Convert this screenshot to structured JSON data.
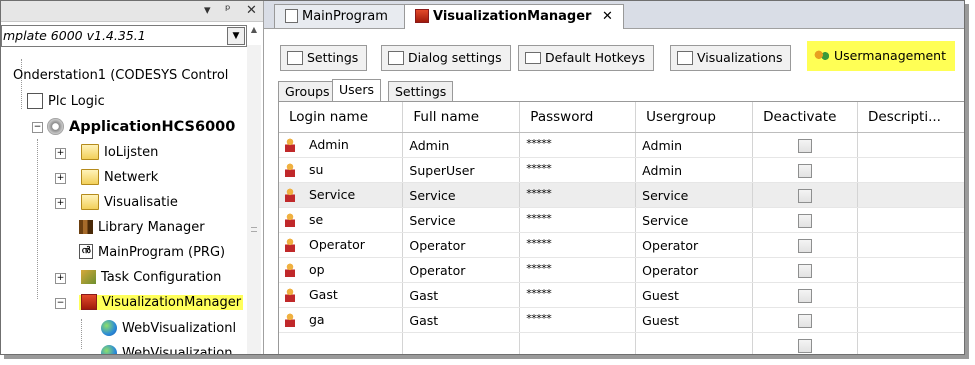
{
  "left_panel": {
    "header_buttons": [
      "▾",
      "ᵖ",
      "✕"
    ],
    "combo_text": "mplate 6000 v1.4.35.1",
    "device": "Onderstation1 (CODESYS Control",
    "plc_logic": "Plc Logic",
    "application": "ApplicationHCS6000",
    "items": [
      {
        "label": "IoLijsten",
        "icon": "folder-icon"
      },
      {
        "label": "Netwerk",
        "icon": "folder-icon"
      },
      {
        "label": "Visualisatie",
        "icon": "folder-icon"
      },
      {
        "label": "Library Manager",
        "icon": "library-icon"
      },
      {
        "label": "MainProgram (PRG)",
        "icon": "program-icon"
      },
      {
        "label": "Task Configuration",
        "icon": "task-icon"
      },
      {
        "label": "VisualizationManager",
        "icon": "visu-manager-icon"
      },
      {
        "label": "WebVisualizationl",
        "icon": "web-visu-icon"
      },
      {
        "label": "WebVisualization",
        "icon": "web-visu-icon"
      }
    ]
  },
  "editor": {
    "doc_tabs": [
      {
        "label": "MainProgram"
      },
      {
        "label": "VisualizationManager"
      }
    ],
    "close_label": "✕",
    "sub_tabs": [
      "Settings",
      "Dialog settings",
      "Default Hotkeys",
      "Visualizations",
      "Usermanagement"
    ],
    "inner_tabs": [
      "Groups",
      "Users",
      "Settings"
    ],
    "columns": [
      "Login name",
      "Full name",
      "Password",
      "Usergroup",
      "Deactivate",
      "Descripti..."
    ],
    "rows": [
      {
        "login": "Admin",
        "full": "Admin",
        "password": "*****",
        "group": "Admin"
      },
      {
        "login": "su",
        "full": "SuperUser",
        "password": "*****",
        "group": "Admin"
      },
      {
        "login": "Service",
        "full": "Service",
        "password": "*****",
        "group": "Service"
      },
      {
        "login": "se",
        "full": "Service",
        "password": "*****",
        "group": "Service"
      },
      {
        "login": "Operator",
        "full": "Operator",
        "password": "*****",
        "group": "Operator"
      },
      {
        "login": "op",
        "full": "Operator",
        "password": "*****",
        "group": "Operator"
      },
      {
        "login": "Gast",
        "full": "Gast",
        "password": "*****",
        "group": "Guest"
      },
      {
        "login": "ga",
        "full": "Gast",
        "password": "*****",
        "group": "Guest"
      }
    ]
  },
  "colors": {
    "highlight": "#ffff55",
    "tab_strip": "#d9dde6",
    "selected_row": "#ededed"
  }
}
